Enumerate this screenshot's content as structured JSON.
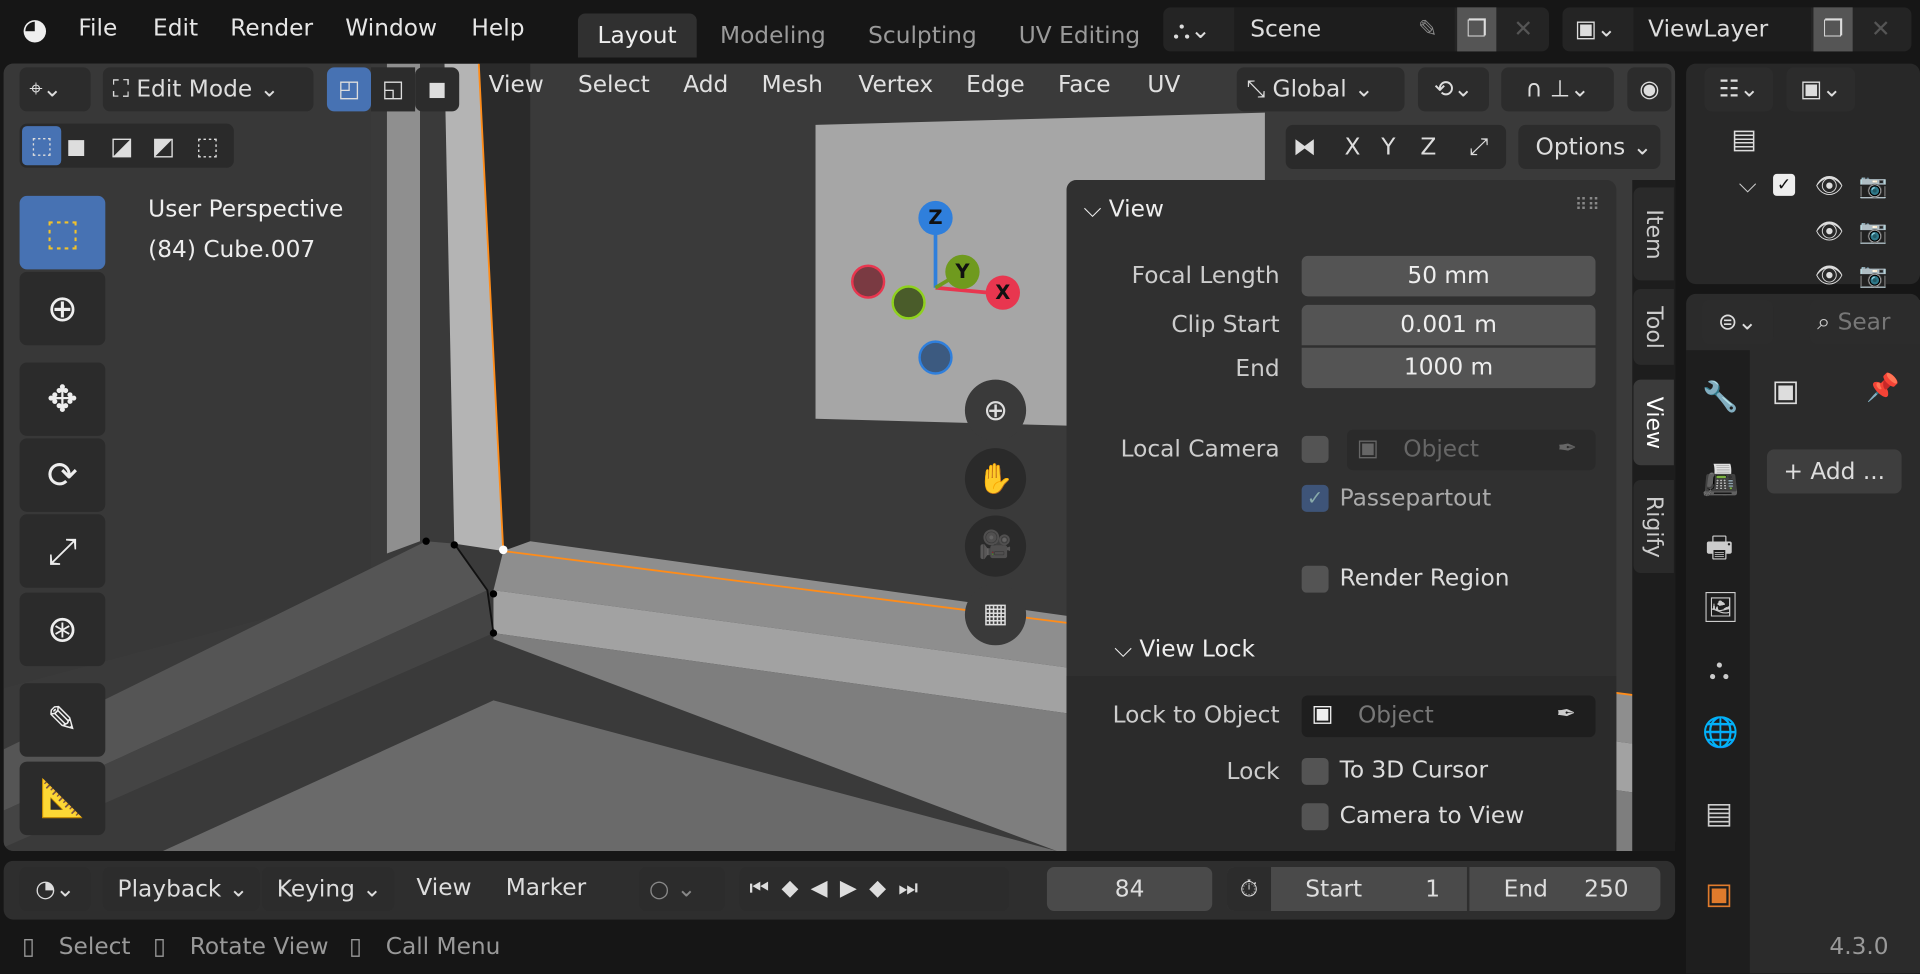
{
  "menu": {
    "file": "File",
    "edit": "Edit",
    "render": "Render",
    "window": "Window",
    "help": "Help"
  },
  "workspaces": [
    "Layout",
    "Modeling",
    "Sculpting",
    "UV Editing"
  ],
  "scene": {
    "name": "Scene"
  },
  "view_layer": {
    "name": "ViewLayer"
  },
  "viewport_header": {
    "mode": "Edit Mode",
    "menus": [
      "View",
      "Select",
      "Add",
      "Mesh",
      "Vertex",
      "Edge",
      "Face",
      "UV"
    ],
    "transform_orientation": "Global",
    "axes": [
      "X",
      "Y",
      "Z"
    ],
    "options": "Options"
  },
  "overlay_text": {
    "perspective": "User Perspective",
    "object": "(84) Cube.007"
  },
  "gizmo": {
    "x": "X",
    "y": "Y",
    "z": "Z"
  },
  "sidebar_tabs": [
    "Item",
    "Tool",
    "View",
    "Rigify"
  ],
  "view_panel": {
    "title": "View",
    "focal_length_label": "Focal Length",
    "focal_length": "50 mm",
    "clip_start_label": "Clip Start",
    "clip_start": "0.001 m",
    "clip_end_label": "End",
    "clip_end": "1000 m",
    "local_camera_label": "Local Camera",
    "local_camera_placeholder": "Object",
    "local_camera_checked": false,
    "passepartout_label": "Passepartout",
    "passepartout_checked": true,
    "render_region_label": "Render Region",
    "render_region_checked": false,
    "view_lock_title": "View Lock",
    "lock_to_object_label": "Lock to Object",
    "lock_to_object_placeholder": "Object",
    "lock_label": "Lock",
    "to_3d_cursor_label": "To 3D Cursor",
    "camera_to_view_label": "Camera to View"
  },
  "properties": {
    "search_placeholder": "Sear",
    "add_label": "Add ..."
  },
  "timeline": {
    "playback": "Playback",
    "keying": "Keying",
    "view": "View",
    "marker": "Marker",
    "current_frame": "84",
    "start_label": "Start",
    "start": "1",
    "end_label": "End",
    "end": "250"
  },
  "status_bar": {
    "select": "Select",
    "rotate_view": "Rotate View",
    "call_menu": "Call Menu",
    "version": "4.3.0"
  },
  "colors": {
    "accent": "#4772b3",
    "selection_orange": "#ff8c19",
    "x_axis": "#e8364f",
    "y_axis": "#6f9a1e",
    "z_axis": "#2f7fdc"
  }
}
